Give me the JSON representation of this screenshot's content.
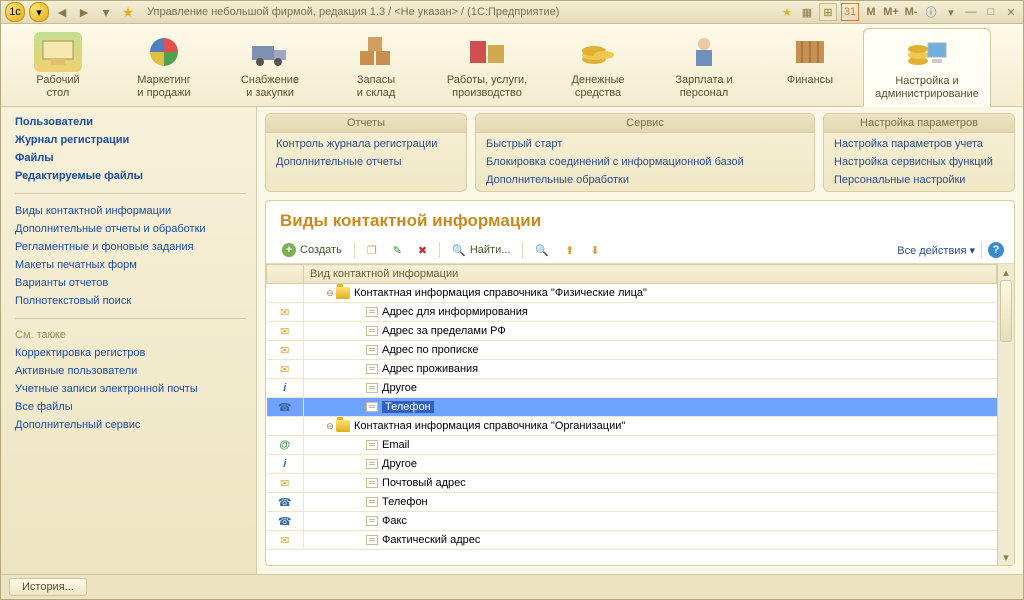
{
  "window": {
    "title": "Управление небольшой фирмой, редакция 1.3 / <Не указан> / (1С:Предприятие)"
  },
  "titlebar_buttons": {
    "m1": "M",
    "m2": "M+",
    "m3": "M-"
  },
  "modules": [
    {
      "label": "Рабочий\nстол"
    },
    {
      "label": "Маркетинг\nи продажи"
    },
    {
      "label": "Снабжение\nи закупки"
    },
    {
      "label": "Запасы\nи склад"
    },
    {
      "label": "Работы, услуги,\nпроизводство"
    },
    {
      "label": "Денежные\nсредства"
    },
    {
      "label": "Зарплата и\nперсонал"
    },
    {
      "label": "Финансы"
    },
    {
      "label": "Настройка и\nадминистрирование"
    }
  ],
  "panels": {
    "reports": {
      "title": "Отчеты",
      "items": [
        "Контроль журнала регистрации",
        "Дополнительные отчеты"
      ]
    },
    "service": {
      "title": "Сервис",
      "items": [
        "Быстрый старт",
        "Блокировка соединений с информационной базой",
        "Дополнительные обработки"
      ]
    },
    "settings": {
      "title": "Настройка параметров",
      "items": [
        "Настройка параметров учета",
        "Настройка сервисных функций",
        "Персональные настройки"
      ]
    }
  },
  "sidebar": {
    "group1": [
      "Пользователи",
      "Журнал регистрации",
      "Файлы",
      "Редактируемые файлы"
    ],
    "group2": [
      "Виды контактной информации",
      "Дополнительные отчеты и обработки",
      "Регламентные и фоновые задания",
      "Макеты печатных форм",
      "Варианты отчетов",
      "Полнотекстовый поиск"
    ],
    "see_also_title": "См. также",
    "group3": [
      "Корректировка регистров",
      "Активные пользователи",
      "Учетные записи электронной почты",
      "Все файлы",
      "Дополнительный сервис"
    ]
  },
  "content": {
    "title": "Виды контактной информации",
    "toolbar": {
      "create": "Создать",
      "find": "Найти...",
      "all_actions": "Все действия"
    },
    "column_header": "Вид контактной информации",
    "rows": [
      {
        "icon": "",
        "indent": 0,
        "expander": "minus",
        "type": "folder",
        "label": "Контактная информация справочника \"Физические лица\"",
        "selected": false
      },
      {
        "icon": "env",
        "indent": 1,
        "type": "item",
        "label": "Адрес для информирования"
      },
      {
        "icon": "env",
        "indent": 1,
        "type": "item",
        "label": "Адрес за пределами РФ"
      },
      {
        "icon": "env",
        "indent": 1,
        "type": "item",
        "label": "Адрес по прописке"
      },
      {
        "icon": "env",
        "indent": 1,
        "type": "item",
        "label": "Адрес проживания"
      },
      {
        "icon": "quest",
        "indent": 1,
        "type": "item",
        "label": "Другое"
      },
      {
        "icon": "phone",
        "indent": 1,
        "type": "item",
        "label": "Телефон",
        "selected": true
      },
      {
        "icon": "",
        "indent": 0,
        "expander": "minus",
        "type": "folder",
        "label": "Контактная информация справочника \"Организации\""
      },
      {
        "icon": "at",
        "indent": 1,
        "type": "item",
        "label": "Email"
      },
      {
        "icon": "quest",
        "indent": 1,
        "type": "item",
        "label": "Другое"
      },
      {
        "icon": "env",
        "indent": 1,
        "type": "item",
        "label": "Почтовый адрес"
      },
      {
        "icon": "phone",
        "indent": 1,
        "type": "item",
        "label": "Телефон"
      },
      {
        "icon": "phone",
        "indent": 1,
        "type": "item",
        "label": "Факс"
      },
      {
        "icon": "env",
        "indent": 1,
        "type": "item",
        "label": "Фактический адрес"
      }
    ]
  },
  "status": {
    "history": "История..."
  }
}
